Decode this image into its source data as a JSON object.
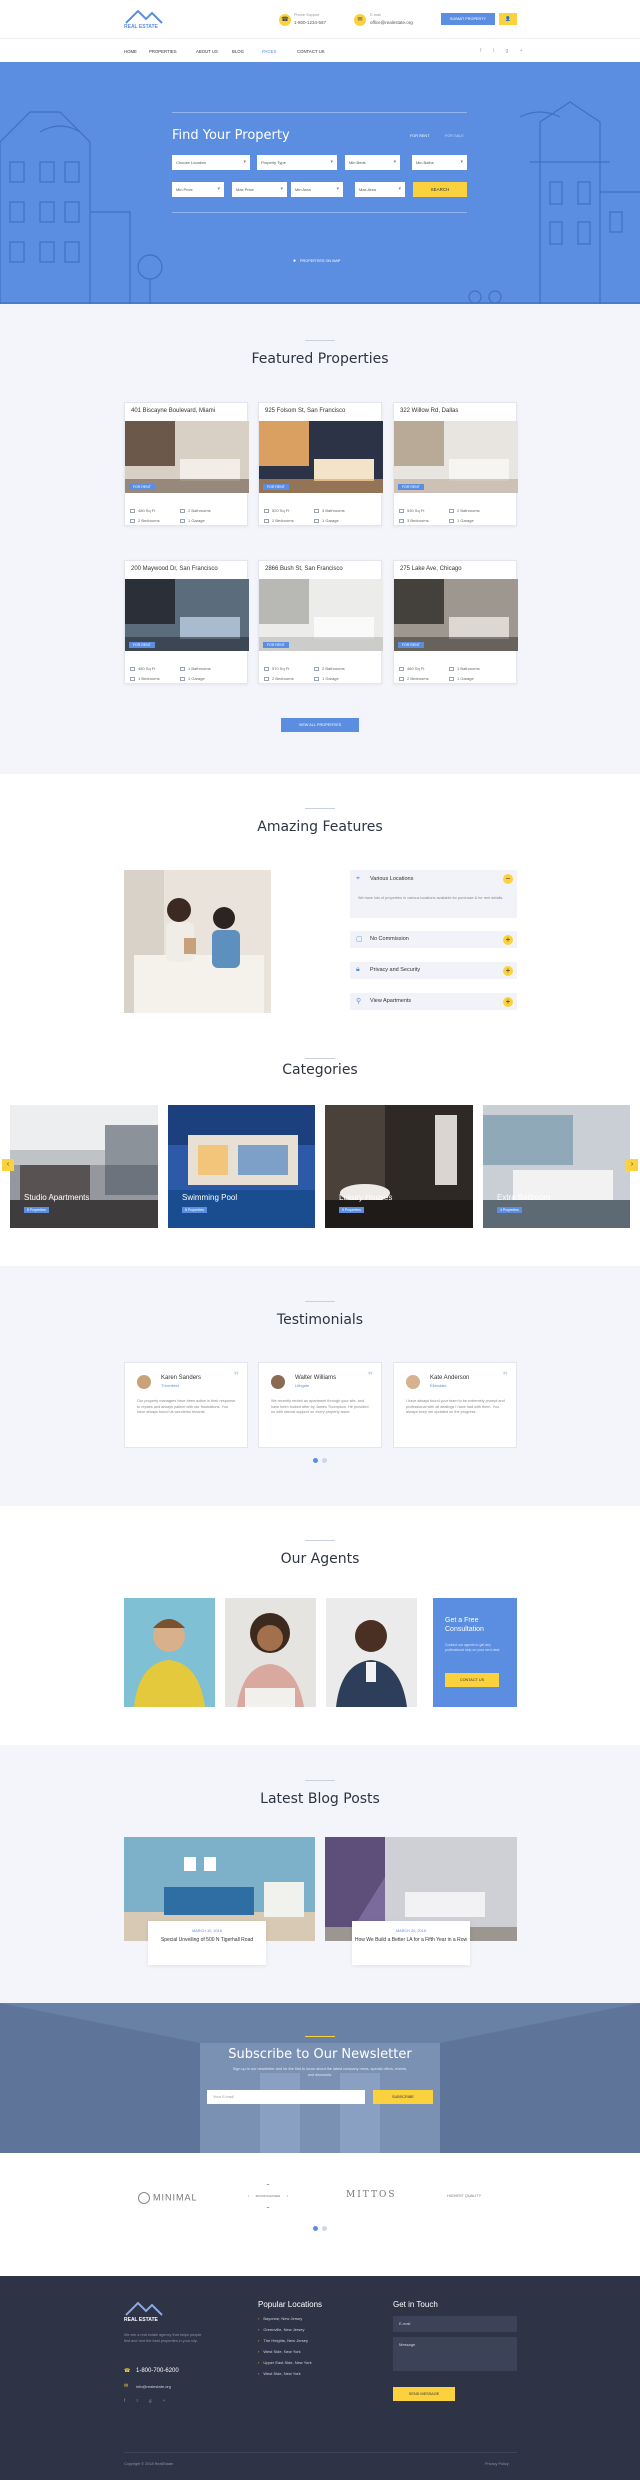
{
  "header": {
    "logo_text": "REAL ESTATE",
    "phone_label": "Phone Support",
    "phone": "1-800-1234-567",
    "email_label": "E-mail",
    "email": "office@realestate.org",
    "submit_label": "SUBMIT PROPERTY",
    "user_icon": "user-icon"
  },
  "nav": {
    "items": [
      "HOME",
      "PROPERTIES",
      "ABOUT US",
      "BLOG",
      "PAGES",
      "CONTACT US"
    ],
    "active": "PAGES"
  },
  "hero": {
    "title": "Find Your Property",
    "tab_rent": "FOR RENT",
    "tab_sale": "FOR SALE",
    "selects_row1": [
      "Choose Location",
      "Property Type",
      "Min Beds",
      "Min Baths"
    ],
    "selects_row2": [
      "Min Price",
      "Max Price",
      "Min Area",
      "Max Area"
    ],
    "search_label": "SEARCH",
    "map_label": "PROPERTIES ON MAP"
  },
  "featured": {
    "title": "Featured Properties",
    "badge": "FOR RENT",
    "properties": [
      {
        "title": "401 Biscayne Boulevard, Miami",
        "area": "480 Sq Ft",
        "beds": "2 Bathrooms",
        "baths": "2 Bedrooms",
        "garage": "1 Garage"
      },
      {
        "title": "925 Folsom St, San Francisco",
        "area": "520 Sq Ft",
        "beds": "3 Bathrooms",
        "baths": "2 Bedrooms",
        "garage": "1 Garage"
      },
      {
        "title": "322 Willow Rd, Dallas",
        "area": "530 Sq Ft",
        "beds": "2 Bathrooms",
        "baths": "3 Bedrooms",
        "garage": "1 Garage"
      },
      {
        "title": "200 Maywood Dr, San Francisco",
        "area": "480 Sq Ft",
        "beds": "1 Bathrooms",
        "baths": "1 Bedrooms",
        "garage": "1 Garage"
      },
      {
        "title": "2866 Bush St, San Francisco",
        "area": "570 Sq Ft",
        "beds": "2 Bathrooms",
        "baths": "2 Bedrooms",
        "garage": "1 Garage"
      },
      {
        "title": "275 Lake Ave, Chicago",
        "area": "460 Sq Ft",
        "beds": "1 Bathrooms",
        "baths": "2 Bedrooms",
        "garage": "1 Garage"
      }
    ],
    "view_all": "VIEW ALL PROPERTIES"
  },
  "features": {
    "title": "Amazing Features",
    "items": [
      "Various Locations",
      "No Commission",
      "Privacy and Security",
      "View Apartments"
    ],
    "desc": "We have lots of properties in various locations available for purchase & for rent details."
  },
  "categories": {
    "title": "Categories",
    "items": [
      {
        "name": "Studio Apartments",
        "count": "8 Properties"
      },
      {
        "name": "Swimming Pool",
        "count": "6 Properties"
      },
      {
        "name": "Luxury Houses",
        "count": "5 Properties"
      },
      {
        "name": "Extra Bedroom",
        "count": "4 Properties"
      }
    ]
  },
  "testimonials": {
    "title": "Testimonials",
    "items": [
      {
        "name": "Karen Sanders",
        "location": "Thornfield",
        "quote": "Our property managers have been active in their response to repairs and always patient with our frustrations. You have always found us wonderful tenants."
      },
      {
        "name": "Walter Williams",
        "location": "Lithgate",
        "quote": "We recently rented an apartment through your site, and have been looked after by James Thompson. He provided us with utmost support on every property issue."
      },
      {
        "name": "Kate Anderson",
        "location": "Ellendale",
        "quote": "I have always found your team to be extremely prompt and professional with all dealings I have had with them. You always keep me updated on the progress."
      }
    ]
  },
  "agents": {
    "title": "Our Agents",
    "cta_title": "Get a Free Consultation",
    "cta_text": "Contact our agents to get any professional help on your next deal.",
    "cta_button": "CONTACT US"
  },
  "blog": {
    "title": "Latest Blog Posts",
    "posts": [
      {
        "date": "MARCH 10, 2018",
        "title": "Special Unveiling of 500 N Tigerhall Road"
      },
      {
        "date": "MARCH 20, 2018",
        "title": "How We Build a Better LA for a Fifth Year in a Row"
      }
    ]
  },
  "newsletter": {
    "title": "Subscribe to Our Newsletter",
    "text": "Sign up to our newsletter and be the first to know about the latest company news, special offers, events, and discounts.",
    "placeholder": "Your E-mail",
    "button": "SUBSCRIBE"
  },
  "partners": [
    "MINIMAL",
    "BOXMOSHOWER",
    "MITTOS",
    "HIGHEST QUALITY"
  ],
  "footer": {
    "logo_text": "REAL ESTATE",
    "about": "We are a real estate agency that helps people find and rent the best properties in your city.",
    "phone": "1-800-700-6200",
    "email": "info@realestate.org",
    "locations_title": "Popular Locations",
    "locations": [
      "Bayonne, New Jersey",
      "Greenville, New Jersey",
      "The Heights, New Jersey",
      "West Side, New York",
      "Upper East Side, New York",
      "West Side, New York"
    ],
    "contact_title": "Get in Touch",
    "field_email": "E-mail",
    "field_message": "Message",
    "send_button": "SEND MESSAGE",
    "copyright": "Copyright © 2018 RealEstate",
    "rights": "Privacy Policy"
  }
}
